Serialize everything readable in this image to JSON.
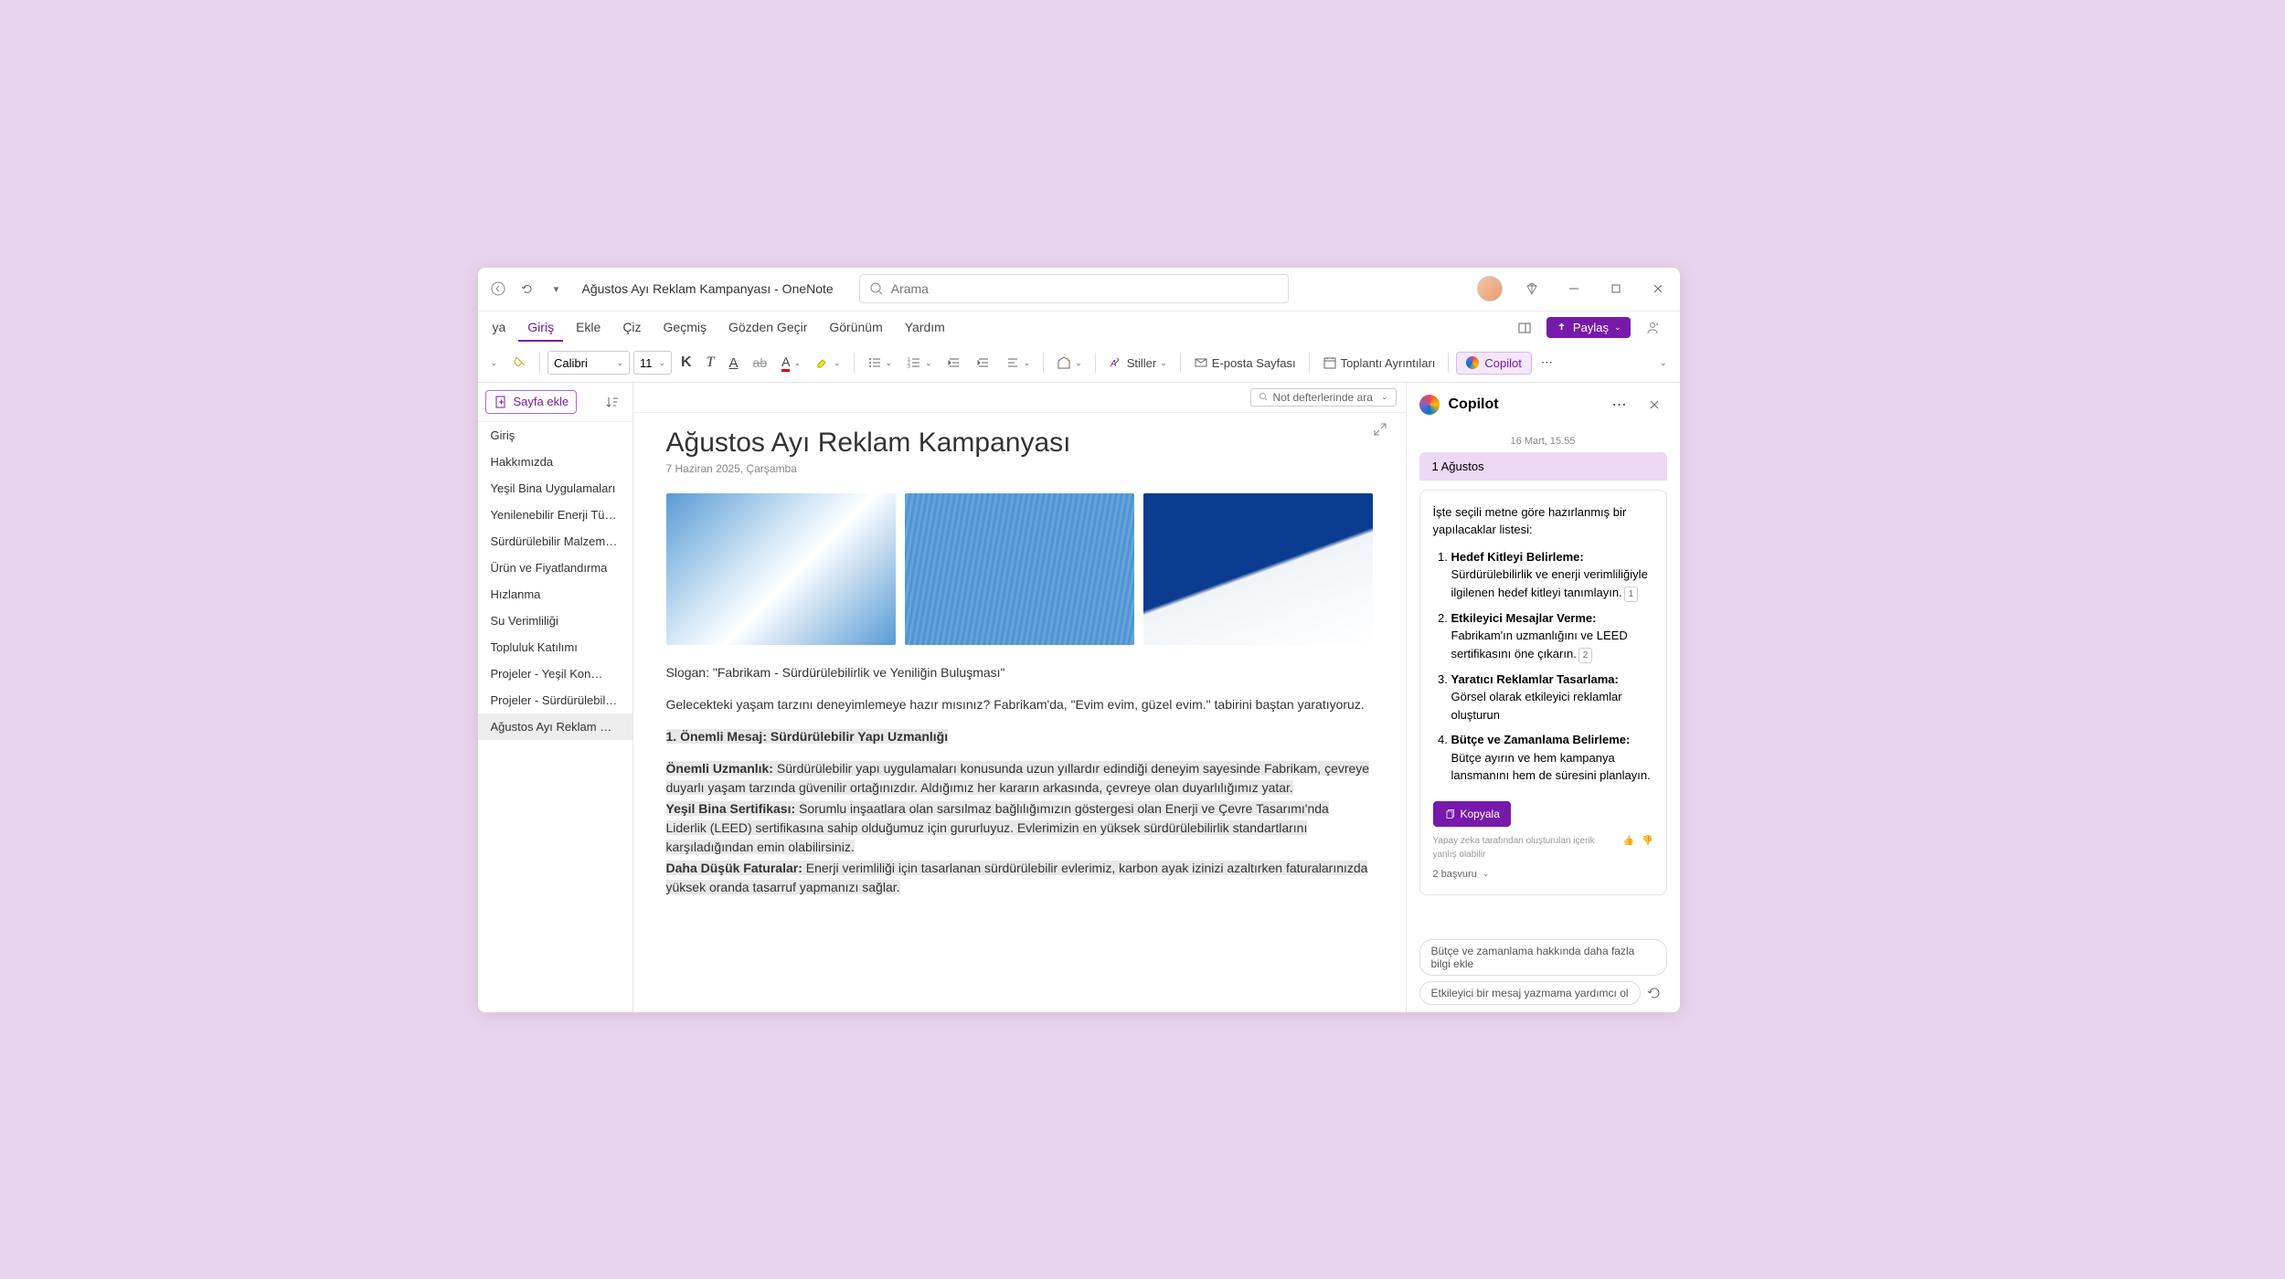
{
  "titlebar": {
    "title": "Ağustos Ayı Reklam Kampanyası - OneNote",
    "search_placeholder": "Arama"
  },
  "ribbon": {
    "tabs": [
      "ya",
      "Giriş",
      "Ekle",
      "Çiz",
      "Geçmiş",
      "Gözden Geçir",
      "Görünüm",
      "Yardım"
    ],
    "active_index": 1,
    "share": "Paylaş"
  },
  "toolbar": {
    "font": "Calibri",
    "size": "11",
    "styles": "Stiller",
    "email": "E-posta Sayfası",
    "meeting": "Toplantı Ayrıntıları",
    "copilot": "Copilot"
  },
  "notebook_search": "Not defterlerinde ara",
  "add_page": "Sayfa ekle",
  "pages": [
    "Giriş",
    "Hakkımızda",
    "Yeşil Bina Uygulamaları",
    "Yenilenebilir Enerji Tümleş…",
    "Sürdürülebilir Malzemeler",
    "Ürün ve Fiyatlandırma",
    "Hızlanma",
    "Su Verimliliği",
    "Topluluk Katılımı",
    "Projeler - Yeşil Kon…",
    "Projeler - Sürdürülebilir B…",
    "Ağustos Ayı Reklam Ka…"
  ],
  "selected_page_index": 11,
  "page": {
    "title": "Ağustos Ayı Reklam Kampanyası",
    "date": "7 Haziran 2025, Çarşamba",
    "slogan": "Slogan: \"Fabrikam - Sürdürülebilirlik ve Yeniliğin Buluşması\"",
    "intro": "Gelecekteki yaşam tarzını deneyimlemeye hazır mısınız? Fabrikam'da, \"Evim evim, güzel evim.\" tabirini baştan yaratıyoruz.",
    "h1": "1. Önemli Mesaj: Sürdürülebilir Yapı Uzmanlığı",
    "b1_label": "Önemli Uzmanlık:",
    "b1_text": " Sürdürülebilir yapı uygulamaları konusunda uzun yıllardır edindiği deneyim sayesinde Fabrikam, çevreye duyarlı yaşam tarzında güvenilir ortağınızdır. Aldığımız her kararın arkasında, çevreye olan duyarlılığımız yatar.",
    "b2_label": "Yeşil Bina Sertifikası:",
    "b2_text": " Sorumlu inşaatlara olan sarsılmaz bağlılığımızın göstergesi olan Enerji ve Çevre Tasarımı'nda Liderlik (LEED) sertifikasına sahip olduğumuz için gururluyuz. Evlerimizin en yüksek sürdürülebilirlik standartlarını karşıladığından emin olabilirsiniz.",
    "b3_label": "Daha Düşük Faturalar:",
    "b3_text": " Enerji verimliliği için tasarlanan sürdürülebilir evlerimiz, karbon ayak izinizi azaltırken faturalarınızda yüksek oranda tasarruf yapmanızı sağlar."
  },
  "copilot": {
    "title": "Copilot",
    "timestamp": "16 Mart, 15.55",
    "context_chip": "1 Ağustos",
    "intro_text": "İşte seçili metne göre hazırlanmış bir yapılacaklar listesi:",
    "items": [
      {
        "title": "Hedef Kitleyi Belirleme:",
        "text": " Sürdürülebilirlik ve enerji verimliliğiyle ilgilenen hedef kitleyi tanımlayın.",
        "ref": "1"
      },
      {
        "title": "Etkileyici Mesajlar Verme:",
        "text": " Fabrikam'ın uzmanlığını ve LEED sertifikasını öne çıkarın.",
        "ref": "2"
      },
      {
        "title": "Yaratıcı Reklamlar Tasarlama:",
        "text": " Görsel olarak etkileyici reklamlar oluşturun"
      },
      {
        "title": "Bütçe ve Zamanlama Belirleme:",
        "text": " Bütçe ayırın ve hem kampanya lansmanını hem de süresini planlayın."
      }
    ],
    "copy": "Kopyala",
    "disclaimer": "Yapay zeka tarafından oluşturulan içerik yanlış olabilir",
    "refs": "2 başvuru",
    "suggestions": [
      "Bütçe ve zamanlama hakkında daha fazla bilgi ekle",
      "Etkileyici bir mesaj yazmama yardımcı ol"
    ]
  }
}
